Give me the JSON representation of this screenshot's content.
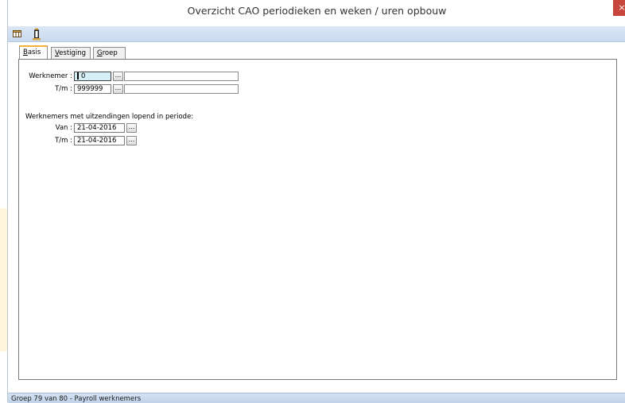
{
  "window": {
    "title": "Overzicht CAO periodieken en weken / uren opbouw",
    "close_label": "×"
  },
  "toolbar": {
    "icons": [
      "table-icon",
      "printer-icon"
    ]
  },
  "tabs": [
    {
      "first": "B",
      "rest": "asis",
      "active": true
    },
    {
      "first": "V",
      "rest": "estiging",
      "active": false
    },
    {
      "first": "G",
      "rest": "roep",
      "active": false
    }
  ],
  "basis": {
    "werknemer_label": "Werknemer :",
    "werknemer_from": "0",
    "tm_label": "T/m :",
    "werknemer_to": "999999",
    "lookup_label": "...",
    "section_label": "Werknemers met uitzendingen lopend in periode:",
    "van_label": "Van :",
    "van_value": "21-04-2016",
    "tm2_label": "T/m :",
    "tm2_value": "21-04-2016"
  },
  "status": {
    "text": "Groep 79 van 80 - Payroll werknemers"
  }
}
